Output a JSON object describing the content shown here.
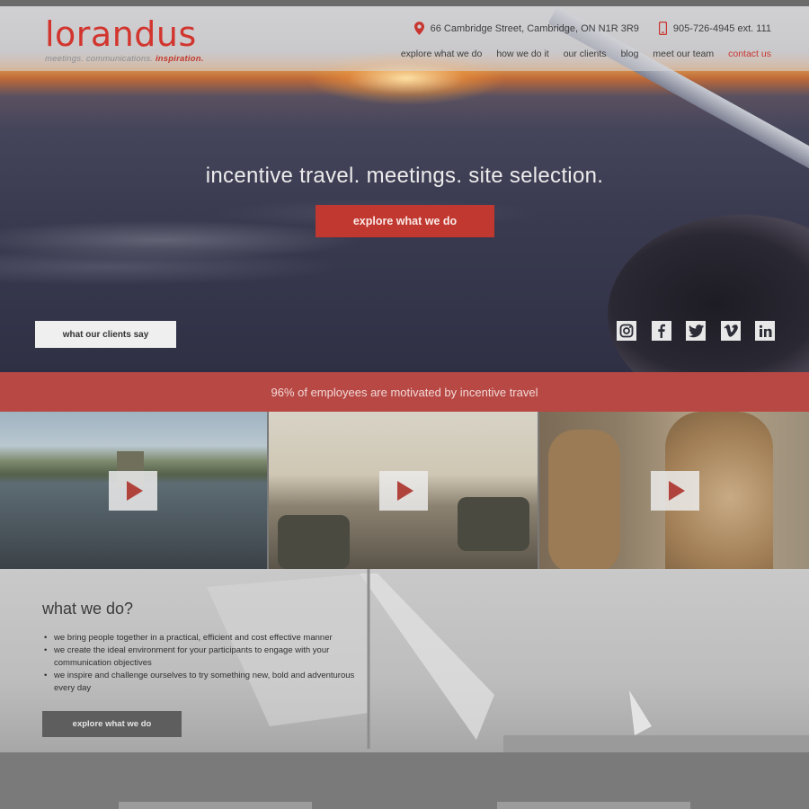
{
  "brand": {
    "logo_text": "lorandus",
    "tagline_prefix": "meetings. communications.",
    "tagline_accent": "inspiration."
  },
  "contact": {
    "address": "66 Cambridge Street, Cambridge, ON  N1R 3R9",
    "phone": "905-726-4945 ext. 111"
  },
  "nav": {
    "items": [
      {
        "label": "explore what we do",
        "active": false
      },
      {
        "label": "how we do it",
        "active": false
      },
      {
        "label": "our clients",
        "active": false
      },
      {
        "label": "blog",
        "active": false
      },
      {
        "label": "meet our team",
        "active": false
      },
      {
        "label": "contact us",
        "active": true
      }
    ]
  },
  "hero": {
    "title": "incentive travel. meetings. site selection.",
    "cta_label": "explore what we do",
    "clients_label": "what our clients say"
  },
  "socials": [
    "instagram-icon",
    "facebook-icon",
    "twitter-icon",
    "vimeo-icon",
    "linkedin-icon"
  ],
  "stat_bar": {
    "text": "96% of employees are motivated by incentive travel"
  },
  "videos": [
    {
      "name": "lake-castle-video"
    },
    {
      "name": "hotel-lobby-video"
    },
    {
      "name": "giraffe-video"
    }
  ],
  "what_we_do": {
    "title": "what we do?",
    "bullets": [
      "we bring people together in a practical, efficient and cost effective manner",
      "we create the ideal environment for your participants to engage with your communication objectives",
      "we inspire and challenge ourselves to try something new, bold and adventurous every day"
    ],
    "cta_label": "explore what we do"
  },
  "colors": {
    "brand_red": "#d2352e",
    "cta_red": "#c0382f",
    "stat_bar": "#b84844"
  }
}
